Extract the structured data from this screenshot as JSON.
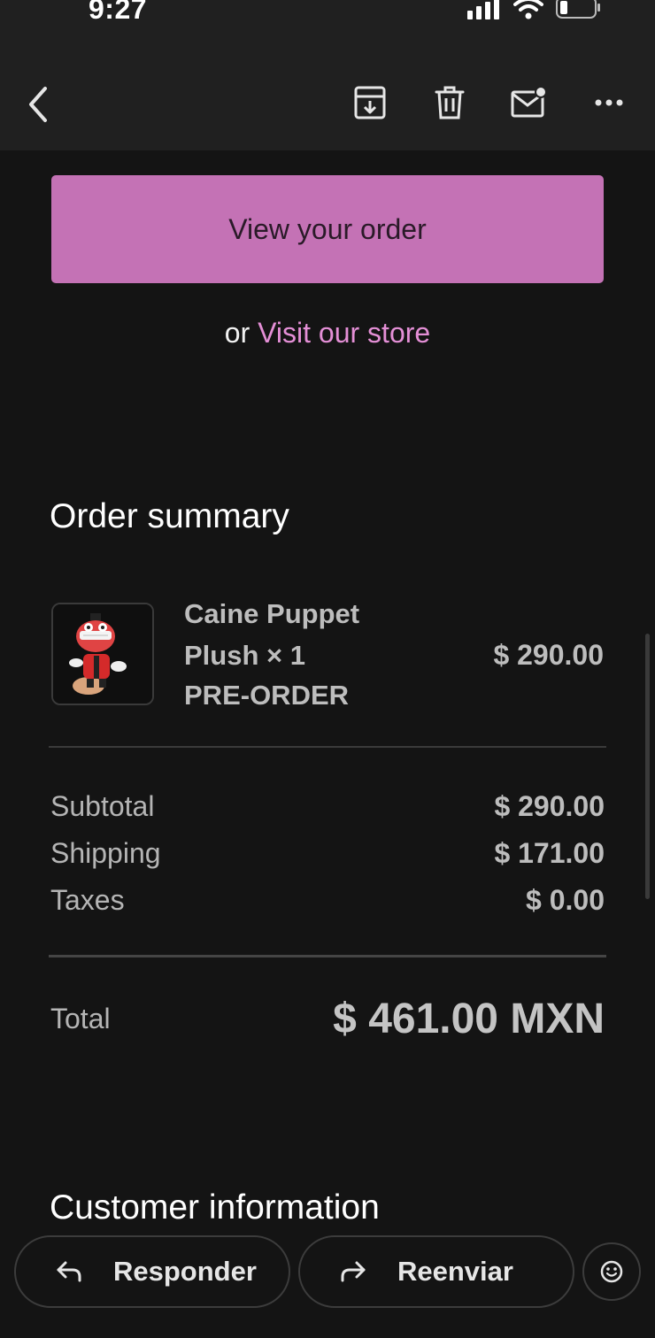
{
  "status_bar": {
    "time": "9:27"
  },
  "toolbar": {
    "back_icon": "chevron-left-icon",
    "archive_icon": "archive-icon",
    "delete_icon": "trash-icon",
    "mark_unread_icon": "mail-unread-icon",
    "more_icon": "more-horizontal-icon"
  },
  "email": {
    "view_order_label": "View your order",
    "or_text": "or ",
    "visit_store_label": "Visit our store",
    "order_summary_title": "Order summary",
    "product": {
      "name": "Caine Puppet Plush × 1",
      "tag": "PRE-ORDER",
      "price": "$ 290.00"
    },
    "summary": [
      {
        "label": "Subtotal",
        "value": "$ 290.00"
      },
      {
        "label": "Shipping",
        "value": "$ 171.00"
      },
      {
        "label": "Taxes",
        "value": "$ 0.00"
      }
    ],
    "total_label": "Total",
    "total_value": "$ 461.00 MXN",
    "customer_info_title": "Customer information"
  },
  "actions": {
    "reply_label": "Responder",
    "forward_label": "Reenviar",
    "emoji_icon": "smiley-icon"
  },
  "colors": {
    "accent": "#c472b5",
    "link": "#e48fd6",
    "background": "#141414",
    "header": "#202020"
  }
}
